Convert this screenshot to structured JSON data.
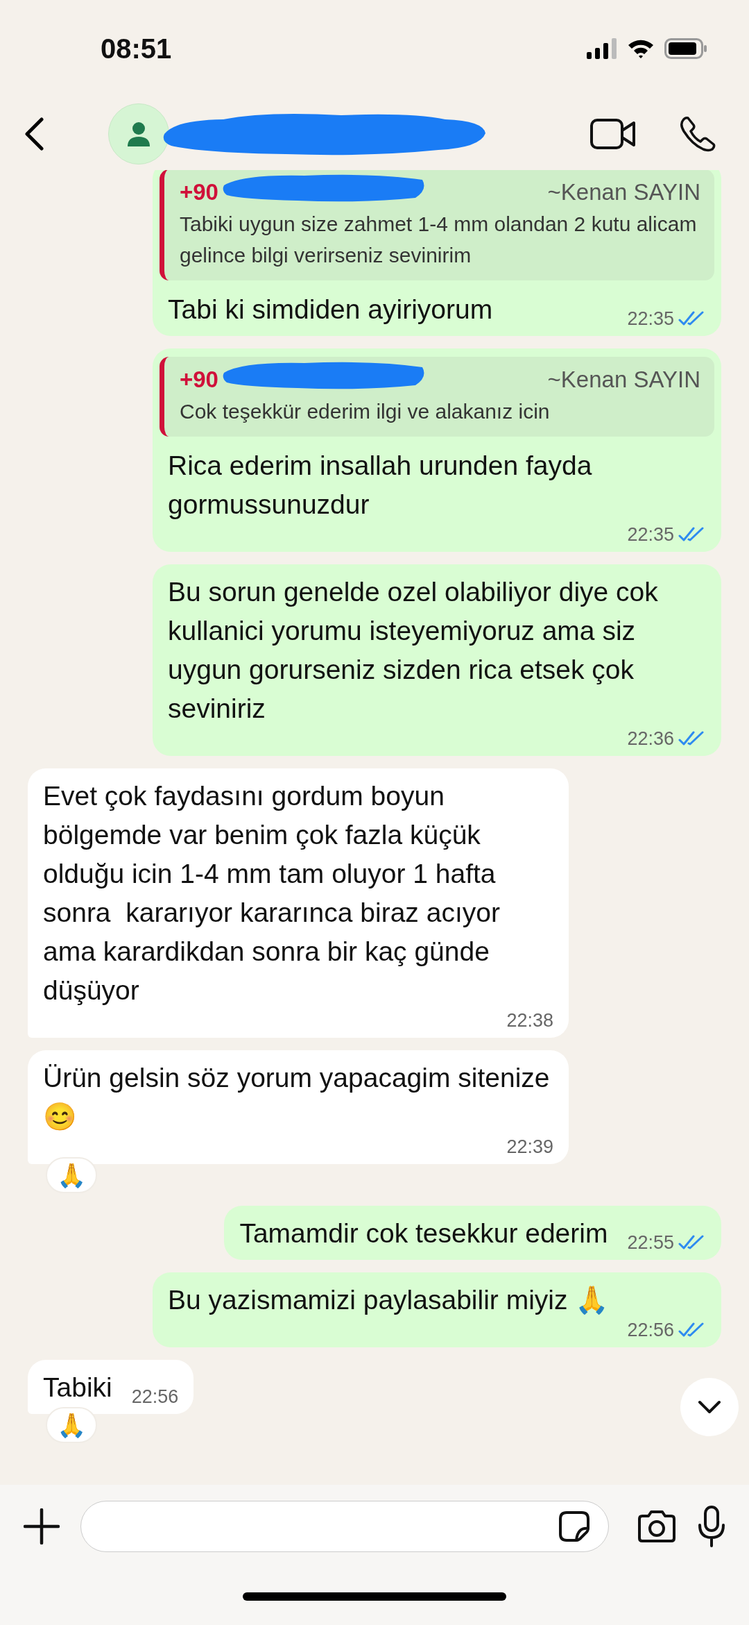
{
  "status_bar": {
    "time": "08:51"
  },
  "messages": [
    {
      "kind": "outgoing",
      "quote": {
        "sender": "+90",
        "author": "~Kenan SAYIN",
        "text": "Tabiki uygun size zahmet 1-4 mm olandan 2 kutu alicam gelince bilgi verirseniz sevinirim"
      },
      "text": "Tabi ki simdiden ayiriyorum",
      "time": "22:35",
      "read": true
    },
    {
      "kind": "outgoing",
      "quote": {
        "sender": "+90",
        "author": "~Kenan SAYIN",
        "text": "Cok teşekkür ederim ilgi ve alakanız icin"
      },
      "text": "Rica ederim insallah urunden fayda gormussunuzdur",
      "time": "22:35",
      "read": true
    },
    {
      "kind": "outgoing",
      "text": "Bu sorun genelde ozel olabiliyor diye cok kullanici yorumu isteyemiyoruz ama siz uygun gorurseniz sizden rica etsek çok seviniriz",
      "time": "22:36",
      "read": true
    },
    {
      "kind": "incoming",
      "text": "Evet çok faydasını gordum boyun bölgemde var benim çok fazla küçük olduğu icin 1-4 mm tam oluyor 1 hafta sonra  kararıyor kararınca biraz acıyor ama karardikdan sonra bir kaç günde düşüyor",
      "time": "22:38"
    },
    {
      "kind": "incoming",
      "text": "Ürün gelsin söz yorum yapacagim sitenize 😊",
      "time": "22:39",
      "reaction": "🙏"
    },
    {
      "kind": "outgoing",
      "text": "Tamamdir cok tesekkur ederim",
      "time": "22:55",
      "read": true
    },
    {
      "kind": "outgoing",
      "text": "Bu yazismamizi paylasabilir miyiz 🙏",
      "time": "22:56",
      "read": true
    },
    {
      "kind": "incoming",
      "text": "Tabiki",
      "time": "22:56",
      "reaction": "🙏"
    }
  ]
}
